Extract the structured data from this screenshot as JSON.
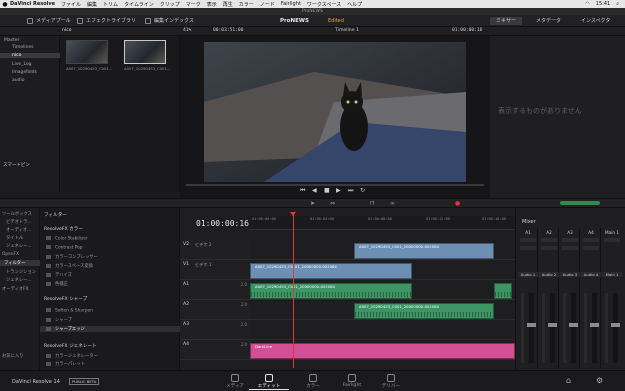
{
  "menubar": {
    "app": "DaVinci Resolve",
    "items": [
      "ファイル",
      "編集",
      "トリム",
      "タイムライン",
      "クリップ",
      "マーク",
      "表示",
      "再生",
      "カラー",
      "ノード",
      "Fairlight",
      "ワークスペース",
      "ヘルプ"
    ],
    "clock": "15:41"
  },
  "window_title": "ProNEWS",
  "toolbar": {
    "media_pool": "メディアプール",
    "effects_library": "エフェクトライブラリ",
    "edit_index": "編集インデックス",
    "project": "ProNEWS",
    "project_status": "Edited",
    "mixer": "ミキサー",
    "metadata": "メタデータ",
    "inspector": "インスペクタ"
  },
  "subbar": {
    "bin_name": "nico",
    "zoom": "41%",
    "source_tc": "00:03:51:00",
    "timeline_name": "Timeline 1",
    "record_tc": "01:00:00:16"
  },
  "media_pool": {
    "bins": [
      "Master",
      "Timelines",
      "nico",
      "Live_Log",
      "Imagefolds",
      "audio"
    ],
    "selected_bin": "nico",
    "smart_bin": "スマートビン"
  },
  "clips": [
    {
      "name": "A007_10290453_C001..."
    },
    {
      "name": "A007_10290453_C001..."
    }
  ],
  "inspector": {
    "empty_message": "表示するものがありません"
  },
  "effects_tree": {
    "items": [
      "ツールボックス",
      "ビデオトラ...",
      "オーディオ...",
      "タイトル",
      "ジェネレー...",
      "OpenFX",
      "フィルター",
      "トランジション",
      "ジェネレー...",
      "オーディオFX"
    ],
    "selected": "フィルター",
    "bottom": "お気に入り"
  },
  "effects_list": {
    "header": "フィルター",
    "sections": [
      {
        "title": "ResolveFX カラー",
        "items": [
          "Color Stabilizer",
          "Contrast Pop",
          "カラーコンプレッサー",
          "カラースペース変換",
          "デハイズ",
          "色補正"
        ]
      },
      {
        "title": "ResolveFX シャープ",
        "items": [
          "Soften & Sharpen",
          "シャープ",
          "シャープエッジ"
        ]
      },
      {
        "title": "ResolveFX ジェネレート",
        "items": [
          "カラージェネレーター",
          "カラーパレット"
        ]
      }
    ],
    "selected": "シャープエッジ"
  },
  "timeline": {
    "timecode": "01:00:00:16",
    "ruler_ticks": [
      "01:00:00:00",
      "01:00:04:00",
      "01:00:08:00",
      "01:00:12:00",
      "01:00:16:00"
    ],
    "tracks": [
      {
        "id": "V2",
        "name": "ビデオ 2",
        "vol": ""
      },
      {
        "id": "V1",
        "name": "ビデオ 1",
        "vol": ""
      },
      {
        "id": "A1",
        "name": "",
        "vol": "2.0"
      },
      {
        "id": "A2",
        "name": "",
        "vol": "2.0"
      },
      {
        "id": "A3",
        "name": "",
        "vol": "2.0"
      },
      {
        "id": "A4",
        "name": "",
        "vol": "2.0"
      }
    ],
    "clips": {
      "v2": "A007_10290453_C001_20000000-002064",
      "v1": "A007_10290453_C0_01_20000000-002064",
      "a1": "A007_10290453_C001_20000000-002064",
      "a2": "A007_10290453_C001_20000000-002064",
      "a4": "DarkLine"
    }
  },
  "mixer": {
    "title": "Mixer",
    "channels": [
      "A1",
      "A2",
      "A3",
      "A4",
      "Main 1"
    ],
    "labels": [
      "Audio 1",
      "Audio 2",
      "Audio 3",
      "Audio 4",
      "Main 1"
    ]
  },
  "pagebar": {
    "brand": "DaVinci Resolve 14",
    "beta": "PUBLIC BETA",
    "tabs": [
      "メディア",
      "エディット",
      "カラー",
      "Fairlight",
      "デリバー"
    ],
    "active": "エディット"
  },
  "colors": {
    "video_clip": "#6d8fb3",
    "audio_clip": "#3d9565",
    "pink_clip": "#d24f93",
    "playhead": "#e0343b",
    "edited": "#e0a93d"
  }
}
